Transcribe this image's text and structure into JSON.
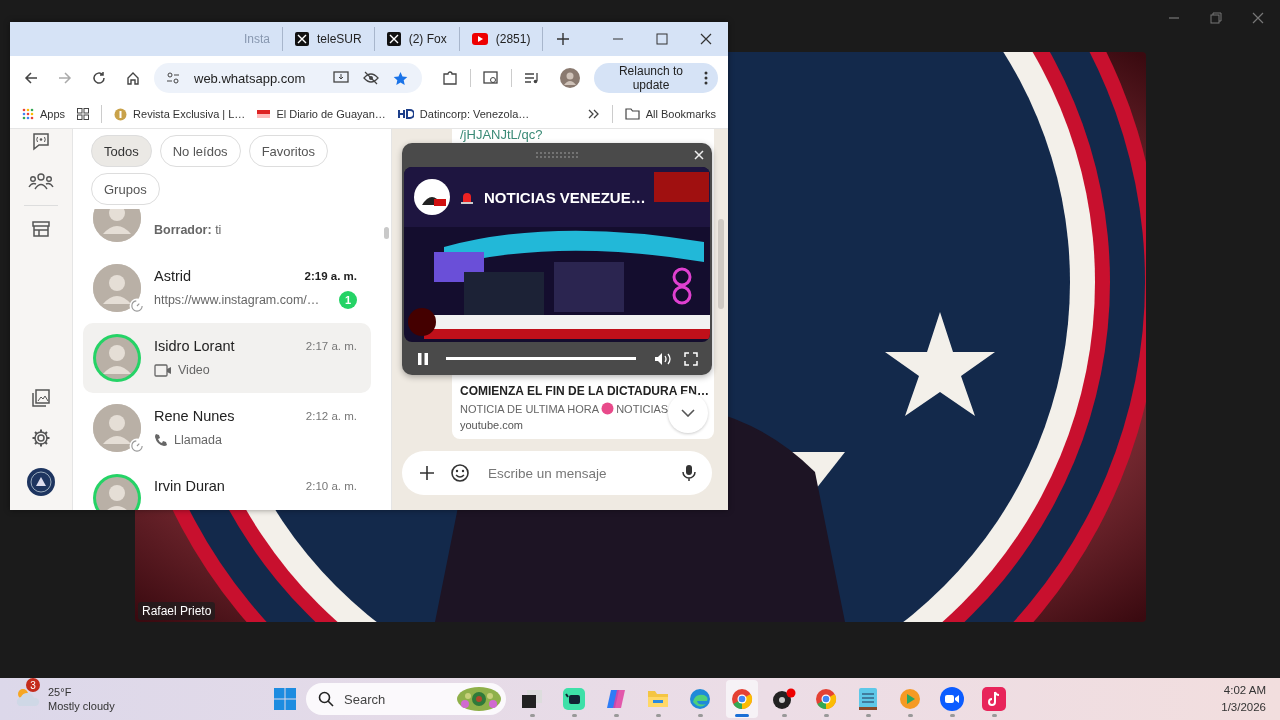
{
  "call": {
    "participant": "Rafael Prieto"
  },
  "browser": {
    "tabs": [
      {
        "label": "Insta",
        "kind": "plain",
        "selected": false
      },
      {
        "label": "teleSUR",
        "kind": "x",
        "selected": false
      },
      {
        "label": "(2) Fox",
        "kind": "x",
        "selected": false
      },
      {
        "label": "(2851)",
        "kind": "video",
        "selected": false
      }
    ],
    "address": "web.whatsapp.com",
    "bookmarked": true,
    "relaunch": "Relaunch to update",
    "bookmarks": [
      {
        "label": "Apps",
        "kind": "apps"
      },
      {
        "label": "Revista Exclusiva | L…",
        "kind": "coin"
      },
      {
        "label": "El Diario de Guayan…",
        "kind": "flag"
      },
      {
        "label": "Datincorp: Venezola…",
        "kind": "hd"
      }
    ],
    "all_bookmarks": "All Bookmarks"
  },
  "whatsapp": {
    "filters": [
      {
        "label": "Todos",
        "selected": true
      },
      {
        "label": "No leídos",
        "selected": false
      },
      {
        "label": "Favoritos",
        "selected": false
      },
      {
        "label": "Grupos",
        "selected": false
      }
    ],
    "chats": [
      {
        "kind": "text",
        "preview": "**Borrador:** ti",
        "selected": false,
        "status_ring": false,
        "timer": false
      },
      {
        "kind": "text",
        "name": "Astrid",
        "time": "2:19 a. m.",
        "preview": "https://www.instagram.com/…",
        "unread": "1",
        "selected": false,
        "status_ring": false,
        "timer": true
      },
      {
        "kind": "video",
        "name": "Isidro Lorant",
        "time": "2:17 a. m.",
        "preview": "Video",
        "selected": true,
        "status_ring": true,
        "timer": false
      },
      {
        "kind": "call",
        "name": "Rene Nunes",
        "time": "2:12 a. m.",
        "preview": "Llamada",
        "selected": false,
        "status_ring": false,
        "timer": true
      },
      {
        "kind": "text",
        "name": "Irvin Duran",
        "time": "2:10 a. m.",
        "selected": false,
        "status_ring": true,
        "timer": false
      }
    ],
    "message": {
      "link": "/jHJANJtL/qc?",
      "title": "COMIENZA EL FIN DE LA DICTADURA EN…",
      "subtitle_start": "NOTICIA DE ULTIMA HORA",
      "subtitle_end": "NOTICIAS",
      "domain": "youtube.com"
    },
    "player": {
      "title": "NOTICIAS VENEZUE…",
      "level": 1
    },
    "composer": {
      "placeholder": "Escribe un mensaje"
    }
  },
  "taskbar": {
    "weather_badge": "3",
    "temperature": "25°F",
    "condition": "Mostly cloudy",
    "search": "Search",
    "apps": [
      {
        "kind": "taskview",
        "active": false
      },
      {
        "kind": "chat",
        "active": false
      },
      {
        "kind": "copilot",
        "active": false
      },
      {
        "kind": "folder",
        "active": false
      },
      {
        "kind": "edge",
        "active": false
      },
      {
        "kind": "chrome",
        "active": true
      },
      {
        "kind": "recorder",
        "active": false
      },
      {
        "kind": "chrome",
        "active": false
      },
      {
        "kind": "notepad",
        "active": false
      },
      {
        "kind": "player",
        "active": false
      },
      {
        "kind": "zoom",
        "active": false
      },
      {
        "kind": "tiktok",
        "active": false
      }
    ],
    "time": "4:02 AM",
    "date": "1/3/2026"
  }
}
